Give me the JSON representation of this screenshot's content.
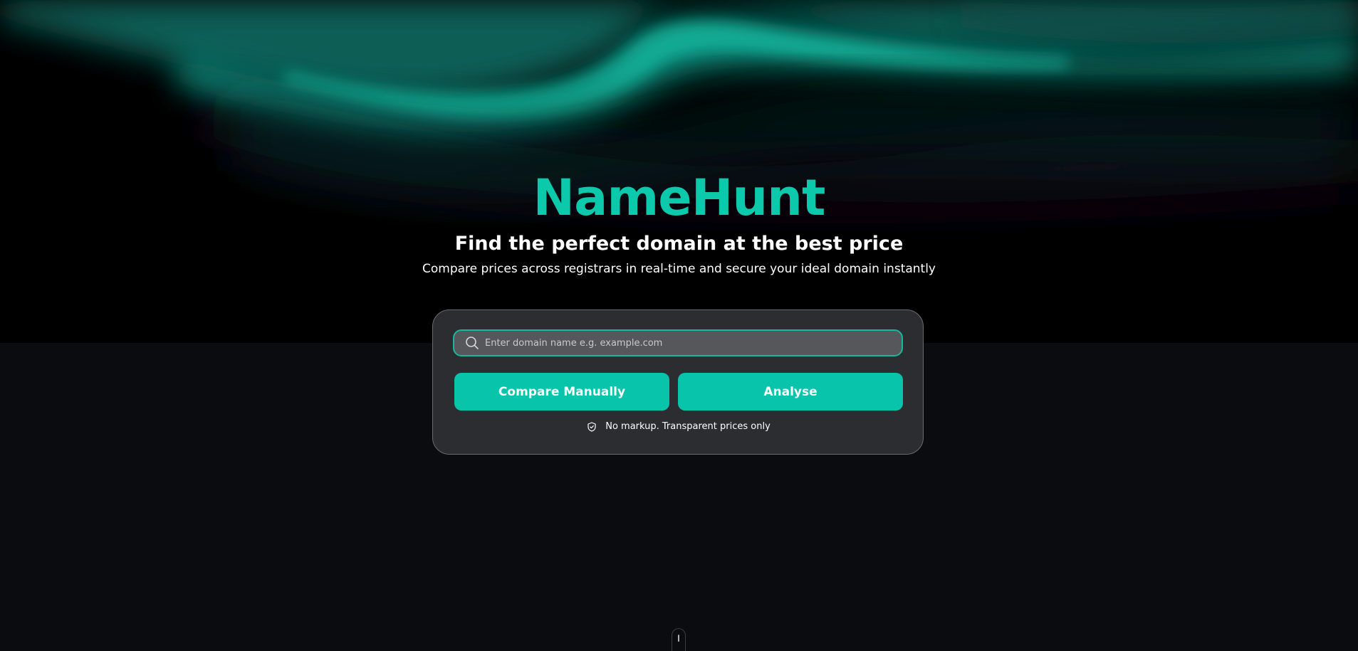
{
  "brand": {
    "name": "NameHunt",
    "accent_color": "#0cc9ac"
  },
  "hero": {
    "headline": "Find the perfect domain at the best price",
    "subheadline": "Compare prices across registrars in real-time and secure your ideal domain instantly"
  },
  "search": {
    "placeholder": "Enter domain name e.g. example.com",
    "value": "",
    "icon": "search-icon"
  },
  "actions": {
    "compare_label": "Compare Manually",
    "analyse_label": "Analyse",
    "button_color": "#08c4ab"
  },
  "note": {
    "icon": "shield-check-icon",
    "text": "No markup. Transparent prices only"
  },
  "scroll": {
    "icon": "scroll-mouse-icon"
  }
}
